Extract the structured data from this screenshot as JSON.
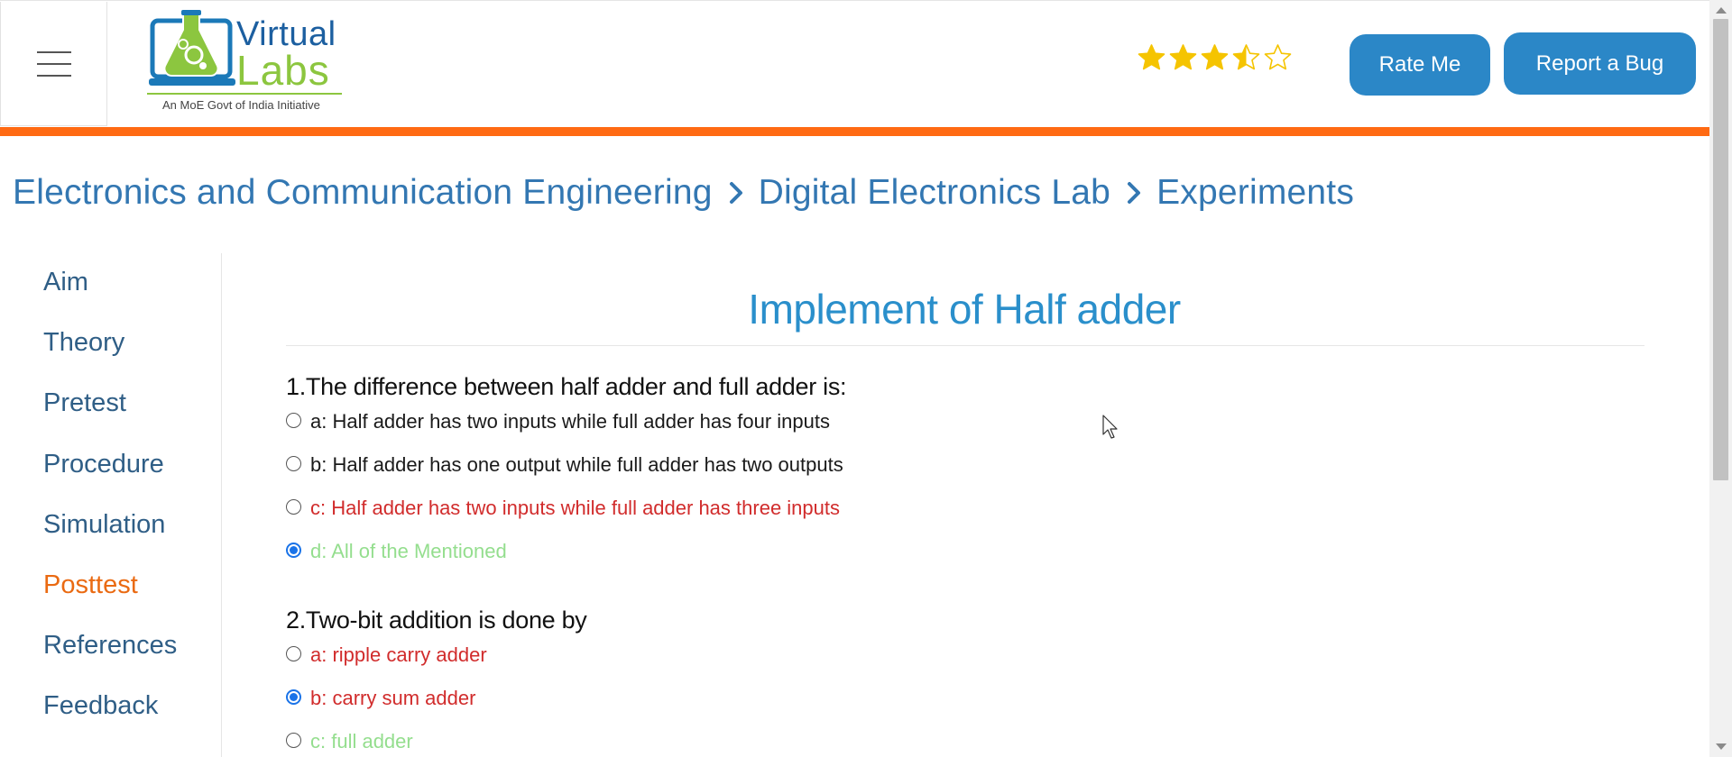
{
  "header": {
    "logo": {
      "word_1": "Virtual",
      "word_2": "Labs",
      "tagline": "An MoE Govt of India Initiative"
    },
    "rating": {
      "value": 3.5,
      "max": 5
    },
    "rate_button": "Rate Me",
    "bug_button": "Report a Bug",
    "accent_color": "#ff6a13"
  },
  "breadcrumb": {
    "items": [
      "Electronics and Communication Engineering",
      "Digital Electronics Lab",
      "Experiments"
    ]
  },
  "sidebar": {
    "items": [
      {
        "label": "Aim",
        "active": false
      },
      {
        "label": "Theory",
        "active": false
      },
      {
        "label": "Pretest",
        "active": false
      },
      {
        "label": "Procedure",
        "active": false
      },
      {
        "label": "Simulation",
        "active": false
      },
      {
        "label": "Posttest",
        "active": true
      },
      {
        "label": "References",
        "active": false
      },
      {
        "label": "Feedback",
        "active": false
      }
    ]
  },
  "main": {
    "title": "Implement of Half adder",
    "questions": [
      {
        "text": "1.The difference between half adder and full adder is:",
        "options": [
          {
            "text": "a: Half adder has two inputs while full adder has four inputs",
            "state": "normal",
            "selected": false
          },
          {
            "text": "b: Half adder has one output while full adder has two outputs",
            "state": "normal",
            "selected": false
          },
          {
            "text": "c: Half adder has two inputs while full adder has three inputs",
            "state": "wrong",
            "selected": false
          },
          {
            "text": "d: All of the Mentioned",
            "state": "right",
            "selected": true
          }
        ]
      },
      {
        "text": "2.Two-bit addition is done by",
        "options": [
          {
            "text": "a: ripple carry adder",
            "state": "wrong",
            "selected": false
          },
          {
            "text": "b: carry sum adder",
            "state": "wrong",
            "selected": true
          },
          {
            "text": "c: full adder",
            "state": "right",
            "selected": false
          }
        ]
      }
    ]
  },
  "colors": {
    "link_blue": "#3377b2",
    "title_blue": "#2a8fcb",
    "active_orange": "#ea6a12",
    "wrong_red": "#d12c2c",
    "right_green": "#94de8e",
    "button_blue": "#2b87c7",
    "star_gold": "#f5c400"
  }
}
